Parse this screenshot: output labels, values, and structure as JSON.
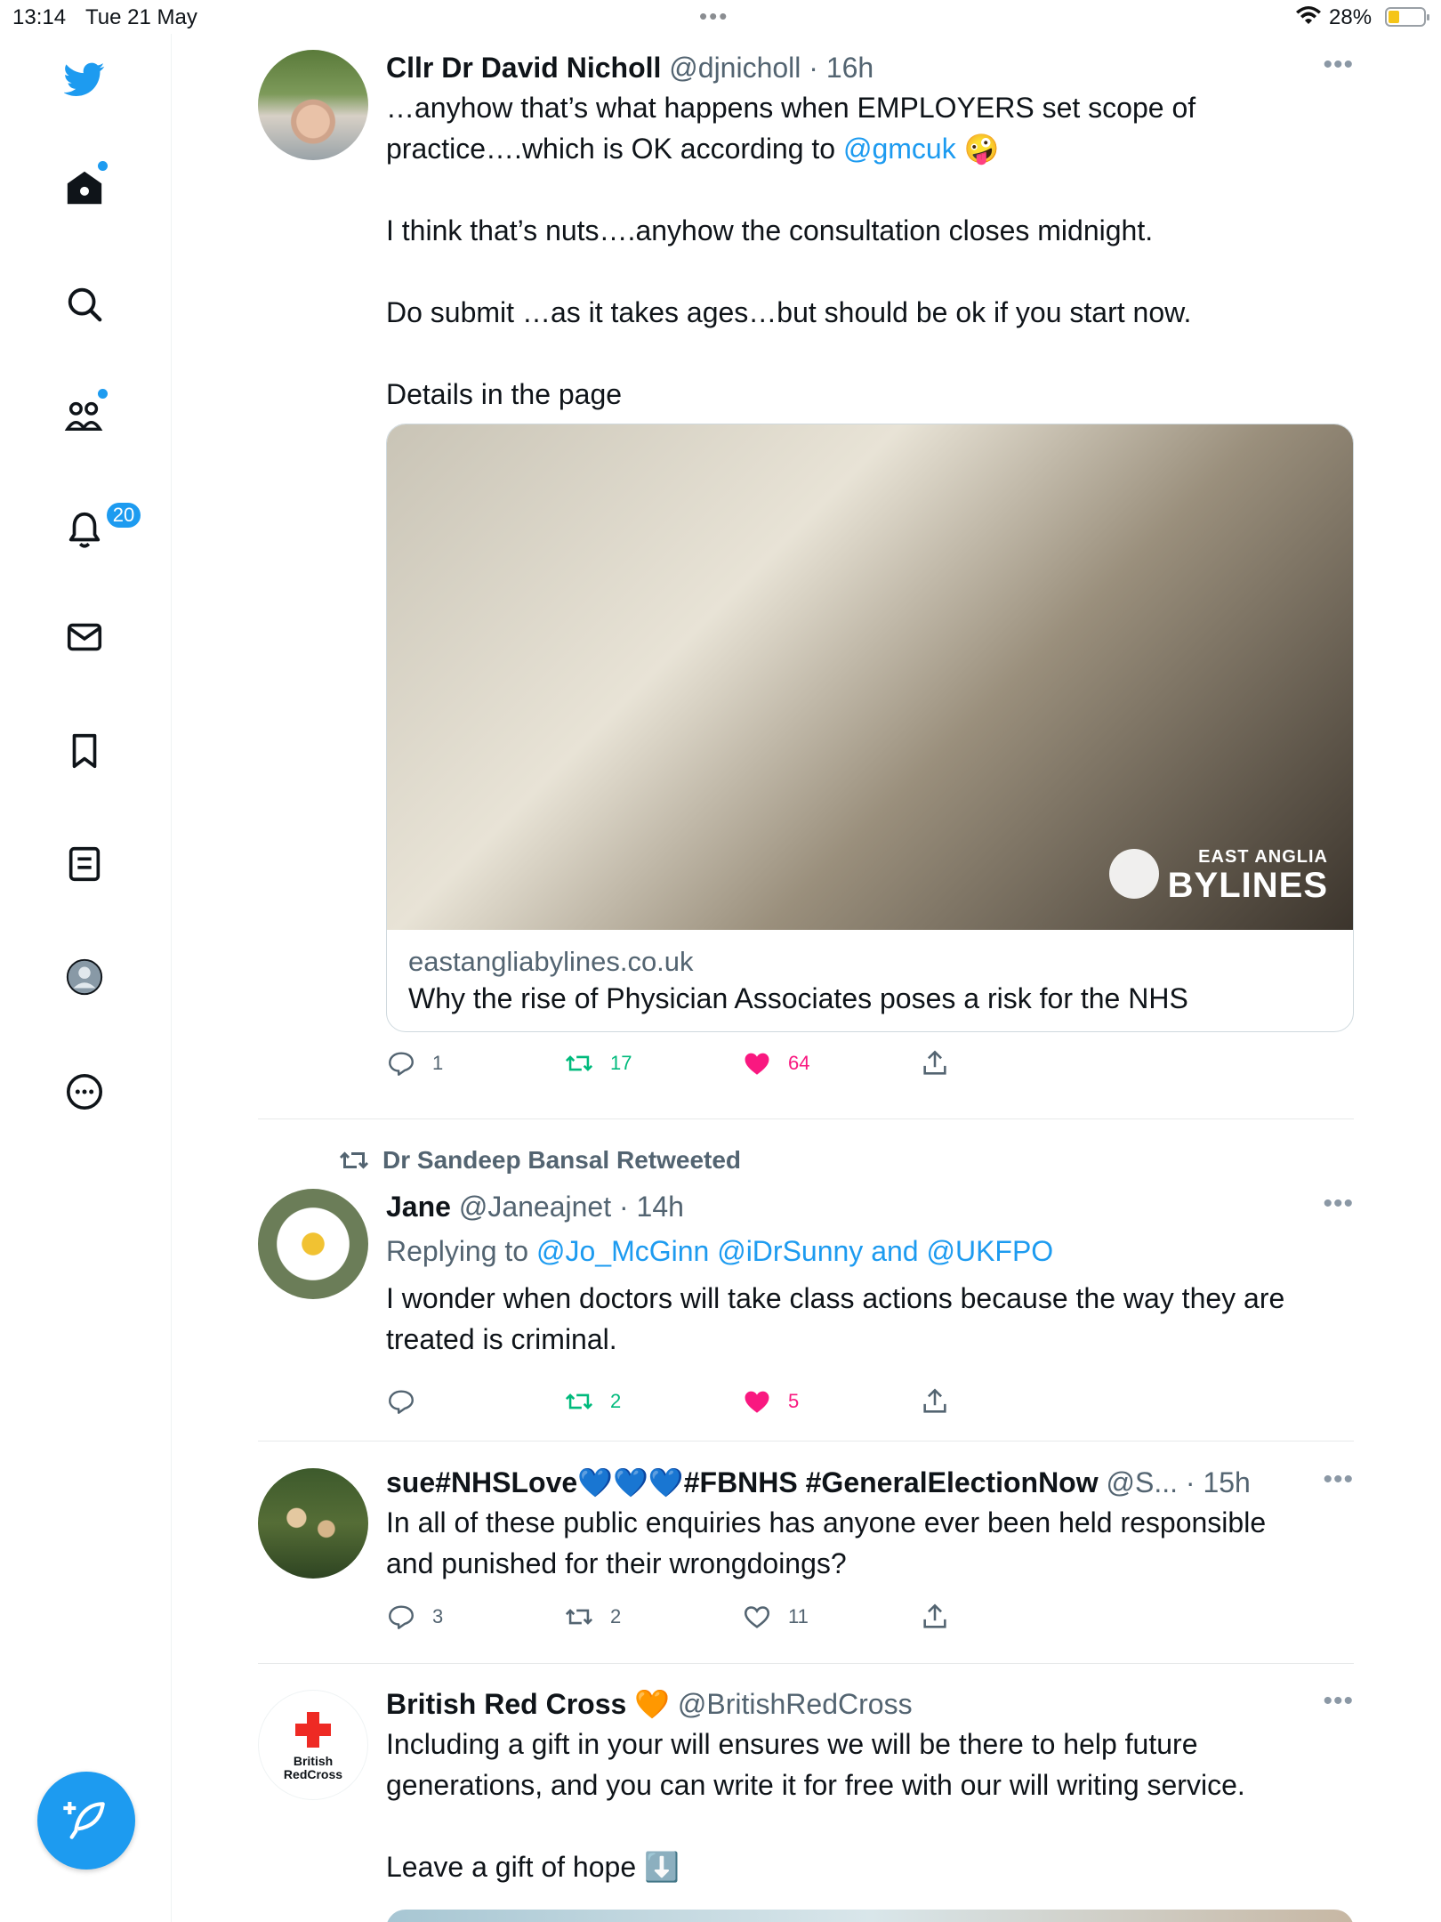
{
  "status_bar": {
    "time": "13:14",
    "date": "Tue 21 May",
    "battery": "28%"
  },
  "sidebar": {
    "notifications_count": "20"
  },
  "tweets": [
    {
      "name": "Cllr Dr David Nicholl",
      "handle": "@djnicholl",
      "time": "· 16h",
      "line1": "…anyhow that’s what happens when EMPLOYERS set scope of",
      "line2_pre": "practice….which is OK according to ",
      "line2_link": "@gmcuk",
      "line2_emoji": "🤪",
      "para2": "I think that’s nuts….anyhow the consultation closes midnight.",
      "para3": "Do submit …as it takes ages…but should be ok if you start now.",
      "para4": "Details in the page",
      "card": {
        "domain": "eastangliabylines.co.uk",
        "title": "Why the rise of Physician Associates poses a risk for the NHS",
        "watermark_line1": "EAST ANGLIA",
        "watermark_line2": "BYLINES"
      },
      "replies": "1",
      "retweets": "17",
      "likes": "64"
    },
    {
      "retweeted_by": "Dr Sandeep Bansal Retweeted",
      "name": "Jane",
      "handle": "@Janeajnet",
      "time": "· 14h",
      "replying_prefix": "Replying to ",
      "replying_users": "@Jo_McGinn @iDrSunny and @UKFPO",
      "line1": "I wonder when doctors will take class actions because the way they are",
      "line2": "treated is criminal.",
      "replies": "",
      "retweets": "2",
      "likes": "5"
    },
    {
      "name": "sue#NHSLove💙💙💙#FBNHS #GeneralElectionNow",
      "handle": "@S...",
      "time": "· 15h",
      "line1": "In all of these public enquiries has anyone ever been held responsible",
      "line2": "and punished for their wrongdoings?",
      "replies": "3",
      "retweets": "2",
      "likes": "11"
    },
    {
      "name": "British Red Cross 🧡",
      "handle": "@BritishRedCross",
      "avatar_text_1": "British",
      "avatar_text_2": "RedCross",
      "line1": "Including a gift in your will ensures we will be there to help future",
      "line2": "generations, and you can write it for free with our will writing service.",
      "para2": "Leave a gift of hope ⬇️"
    }
  ]
}
